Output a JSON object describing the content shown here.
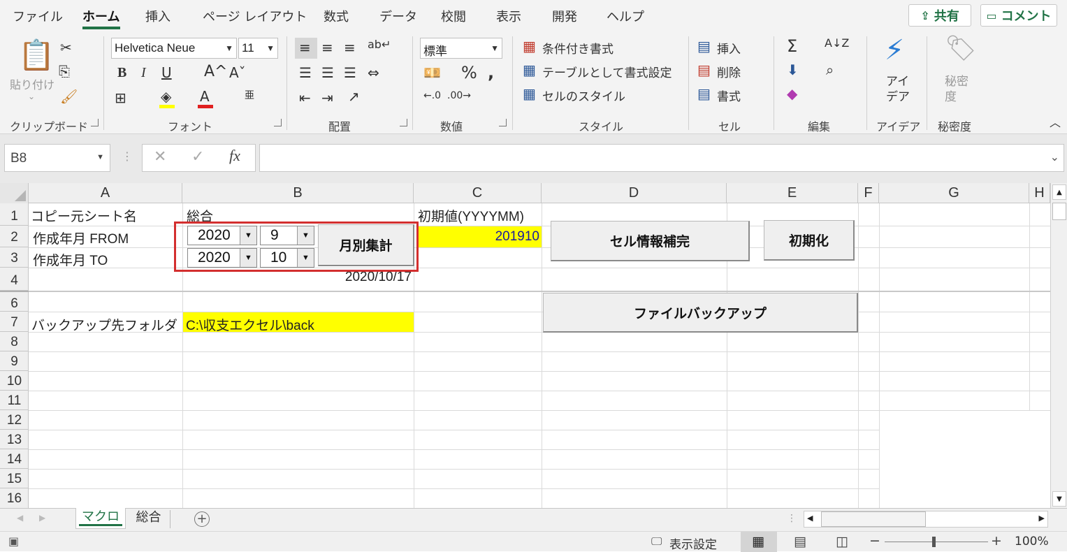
{
  "menu": {
    "items": [
      "ファイル",
      "ホーム",
      "挿入",
      "ページ レイアウト",
      "数式",
      "データ",
      "校閲",
      "表示",
      "開発",
      "ヘルプ"
    ],
    "share": "共有",
    "comment": "コメント"
  },
  "ribbon": {
    "clipboard": {
      "paste": "貼り付け",
      "label": "クリップボード"
    },
    "font": {
      "name": "Helvetica Neue",
      "size": "11",
      "label": "フォント"
    },
    "align": {
      "label": "配置"
    },
    "number": {
      "format": "標準",
      "label": "数値"
    },
    "styles": {
      "conditional": "条件付き書式",
      "table": "テーブルとして書式設定",
      "cellstyle": "セルのスタイル",
      "label": "スタイル"
    },
    "cells": {
      "insert": "挿入",
      "delete": "削除",
      "format": "書式",
      "label": "セル"
    },
    "editing": {
      "label": "編集"
    },
    "ideas": {
      "btn": "アイ\nデア",
      "label": "アイデア"
    },
    "sensitivity": {
      "btn": "秘密\n度",
      "label": "秘密度"
    }
  },
  "formula": {
    "namebox": "B8",
    "value": ""
  },
  "columns": [
    "A",
    "B",
    "C",
    "D",
    "E",
    "F",
    "G",
    "H"
  ],
  "rows": [
    "1",
    "2",
    "3",
    "4",
    "6",
    "7",
    "8",
    "9",
    "10",
    "11",
    "12",
    "13",
    "14",
    "15",
    "16"
  ],
  "cells": {
    "a1": "コピー元シート名",
    "b1": "総合",
    "c1": "初期値(YYYYMM)",
    "a2": "作成年月 FROM",
    "a3": "作成年月 TO",
    "c2": "201910",
    "b4": "2020/10/17",
    "a7": "バックアップ先フォルダ",
    "b7": "C:\\収支エクセル\\back"
  },
  "controls": {
    "from_year": "2020",
    "from_month": "9",
    "to_year": "2020",
    "to_month": "10",
    "monthly_btn": "月別集計",
    "complete_btn": "セル情報補完",
    "init_btn": "初期化",
    "backup_btn": "ファイルバックアップ"
  },
  "tabs": {
    "sheets": [
      "マクロ",
      "総合"
    ]
  },
  "status": {
    "view_settings": "表示設定",
    "zoom": "100%"
  },
  "colors": {
    "accent": "#217346",
    "highlight": "#ffff00",
    "red_box": "#d32f2f"
  }
}
